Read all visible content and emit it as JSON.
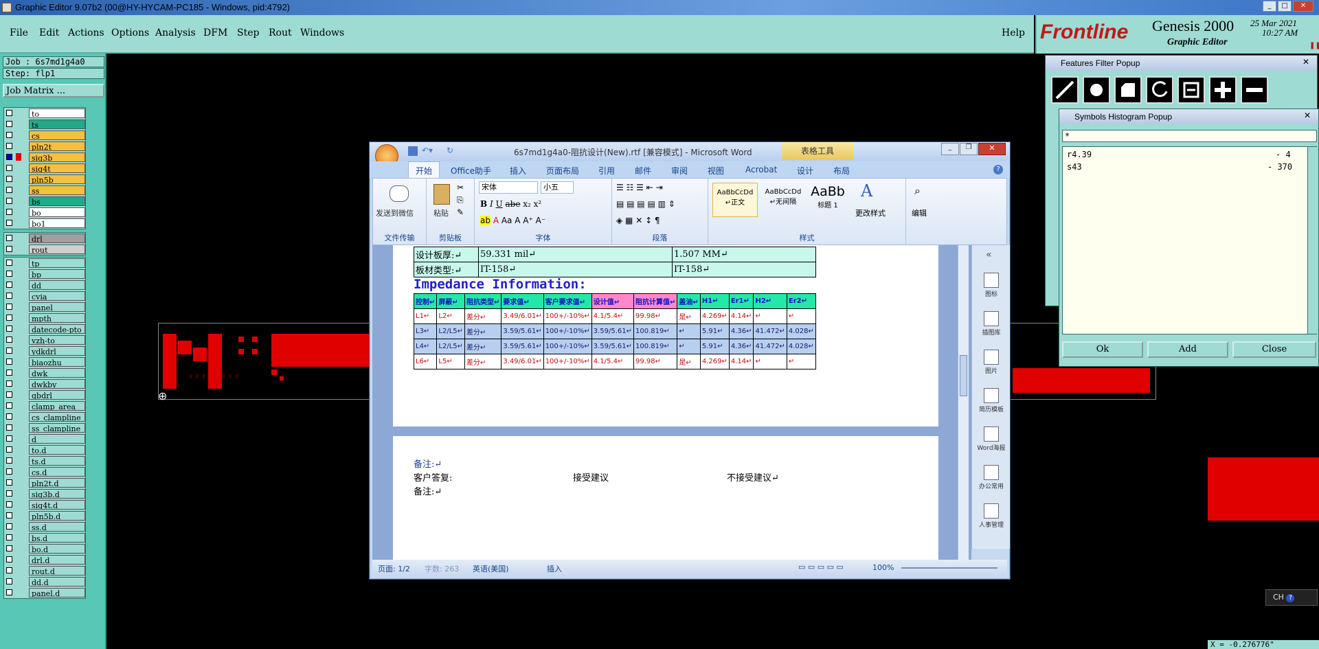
{
  "window": {
    "title": "Graphic Editor 9.07b2 (00@HY-HYCAM-PC185 - Windows, pid:4792)"
  },
  "menu": [
    "File",
    "Edit",
    "Actions",
    "Options",
    "Analysis",
    "DFM",
    "Step",
    "Rout",
    "Windows"
  ],
  "help": "Help",
  "brand": {
    "logo": "Frontline",
    "product": "Genesis 2000",
    "sub": "Graphic Editor",
    "date": "25 Mar 2021",
    "time": "10:27 AM"
  },
  "job": {
    "job": "Job : 6s7md1g4a0",
    "step": "Step: flp1",
    "matrix_button": "Job Matrix ..."
  },
  "layers_top": [
    {
      "name": "to",
      "color": "#ffffff"
    },
    {
      "name": "ts",
      "color": "#22aa88"
    },
    {
      "name": "cs",
      "color": "#f5c040"
    },
    {
      "name": "pln2t",
      "color": "#f5c040"
    },
    {
      "name": "sig3b",
      "color": "#f5c040",
      "active": true
    },
    {
      "name": "sig4t",
      "color": "#f5c040"
    },
    {
      "name": "pln5b",
      "color": "#f5c040"
    },
    {
      "name": "ss",
      "color": "#f5c040"
    },
    {
      "name": "bs",
      "color": "#22aa88"
    },
    {
      "name": "bo",
      "color": "#ffffff"
    },
    {
      "name": "bo1",
      "color": "#ffffff"
    }
  ],
  "layers_drill": [
    {
      "name": "drl",
      "color": "#a0a0a0"
    },
    {
      "name": "rout",
      "color": "#d0d0d0"
    }
  ],
  "layers_misc": [
    "tp",
    "bp",
    "dd",
    "cvia",
    "panel",
    "mpth",
    "datecode-pto",
    "vzh-to",
    "ydkdrl",
    "biaozhu",
    "dwk",
    "dwkby",
    "gbdrl",
    "clamp_area",
    "cs_clampline",
    "ss_clampline",
    "d",
    "to.d",
    "ts.d",
    "cs.d",
    "pln2t.d",
    "sig3b.d",
    "sig4t.d",
    "pln5b.d",
    "ss.d",
    "bs.d",
    "bo.d",
    "drl.d",
    "rout.d",
    "dd.d",
    "panel.d"
  ],
  "word": {
    "title": "6s7md1g4a0-阻抗设计(New).rtf [兼容模式] - Microsoft Word",
    "table_tools": "表格工具",
    "tabs": [
      "开始",
      "Office助手",
      "插入",
      "页面布局",
      "引用",
      "邮件",
      "审阅",
      "视图",
      "Acrobat",
      "设计",
      "布局"
    ],
    "font_name": "宋体",
    "font_size": "小五",
    "groups": [
      "文件传输",
      "剪贴板",
      "字体",
      "段落",
      "样式",
      "编辑"
    ],
    "send_wechat": "发送到微信",
    "paste": "粘贴",
    "styles": [
      {
        "sample": "AaBbCcDd",
        "name": "↵正文"
      },
      {
        "sample": "AaBbCcDd",
        "name": "↵无间隔"
      },
      {
        "sample": "AaBb",
        "name": "标题 1"
      }
    ],
    "change_style": "更改样式",
    "edit": "编辑",
    "rows_top": [
      [
        "设计板厚:↵",
        "59.331 mil↵",
        "1.507 MM↵"
      ],
      [
        "板材类型:↵",
        "IT-158↵",
        "IT-158↵"
      ]
    ],
    "heading": "Impedance Information:",
    "imp_header": [
      "控制↵",
      "屏蔽↵",
      "阻抗类型↵",
      "要求值↵",
      "客户要求值↵",
      "设计值↵",
      "阻抗计算值↵",
      "盖油↵",
      "H1↵",
      "Er1↵",
      "H2↵",
      "Er2↵"
    ],
    "imp_rows": [
      [
        "L1↵",
        "L2↵",
        "差分↵",
        "3.49/6.01↵",
        "100+/-10%↵",
        "4.1/5.4↵",
        "99.98↵",
        "是↵",
        "4.269↵",
        "4.14↵",
        "↵",
        "↵"
      ],
      [
        "L3↵",
        "L2/L5↵",
        "差分↵",
        "3.59/5.61↵",
        "100+/-10%↵",
        "3.59/5.61↵",
        "100.819↵",
        "↵",
        "5.91↵",
        "4.36↵",
        "41.472↵",
        "4.028↵"
      ],
      [
        "L4↵",
        "L2/L5↵",
        "差分↵",
        "3.59/5.61↵",
        "100+/-10%↵",
        "3.59/5.61↵",
        "100.819↵",
        "↵",
        "5.91↵",
        "4.36↵",
        "41.472↵",
        "4.028↵"
      ],
      [
        "L6↵",
        "L5↵",
        "差分↵",
        "3.49/6.01↵",
        "100+/-10%↵",
        "4.1/5.4↵",
        "99.98↵",
        "是↵",
        "4.269↵",
        "4.14↵",
        "↵",
        "↵"
      ]
    ],
    "notes": [
      "备注:↵",
      "客户答复:",
      "接受建议",
      "不接受建议↵",
      "备注:↵"
    ],
    "sidebar": [
      "图标",
      "插图库",
      "图片",
      "简历模板",
      "Word海报",
      "办公常用",
      "人事管理"
    ],
    "status": {
      "page": "页面: 1/2",
      "words": "字数: 263",
      "lang": "英语(美国)",
      "mode": "插入",
      "zoom": "100%"
    }
  },
  "features_popup": {
    "title": "Features Filter Popup"
  },
  "symbols_popup": {
    "title": "Symbols Histogram Popup",
    "filter": "*",
    "rows": [
      {
        "sym": "r4.39",
        "count": "- 4"
      },
      {
        "sym": "s43",
        "count": "- 370"
      }
    ],
    "ok": "Ok",
    "add": "Add",
    "close": "Close"
  },
  "lang_indicator": "CH",
  "coord": "X = -0.276776\""
}
